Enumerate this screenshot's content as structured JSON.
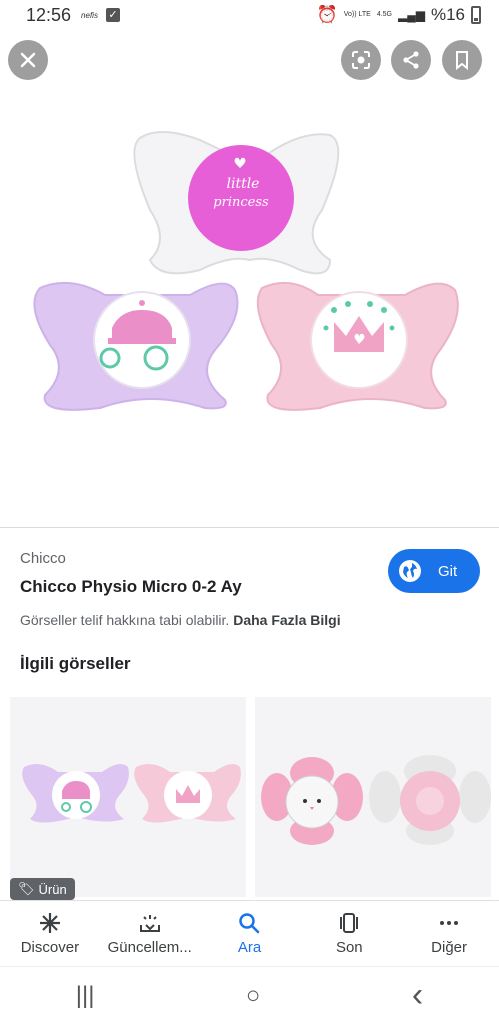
{
  "status": {
    "time": "12:56",
    "nefis": "nefis",
    "volte": "Vo)) LTE",
    "network": "4.5G",
    "battery": "%16"
  },
  "viewer": {
    "close_icon": "close-icon",
    "lens_icon": "lens-icon",
    "share_icon": "share-icon",
    "bookmark_icon": "bookmark-icon"
  },
  "image_text": {
    "line1": "little",
    "line2": "princess"
  },
  "result": {
    "source": "Chicco",
    "title": "Chicco Physio Micro 0-2 Ay",
    "go_button": "Git",
    "copyright": "Görseller telif hakkına tabi olabilir.",
    "more_info": "Daha Fazla Bilgi"
  },
  "related": {
    "heading": "İlgili görseller",
    "badge": "Ürün"
  },
  "bottom_nav": {
    "items": [
      {
        "label": "Discover",
        "icon": "asterisk-icon"
      },
      {
        "label": "Güncellem...",
        "icon": "updates-icon"
      },
      {
        "label": "Ara",
        "icon": "search-icon"
      },
      {
        "label": "Son",
        "icon": "recent-icon"
      },
      {
        "label": "Diğer",
        "icon": "more-icon"
      }
    ],
    "active": "Ara"
  },
  "system_nav": {
    "recents": "|||",
    "home": "○",
    "back": "‹"
  },
  "colors": {
    "accent": "#1a73e8",
    "pink": "#e91e8c",
    "lilac": "#d7c3ef"
  }
}
